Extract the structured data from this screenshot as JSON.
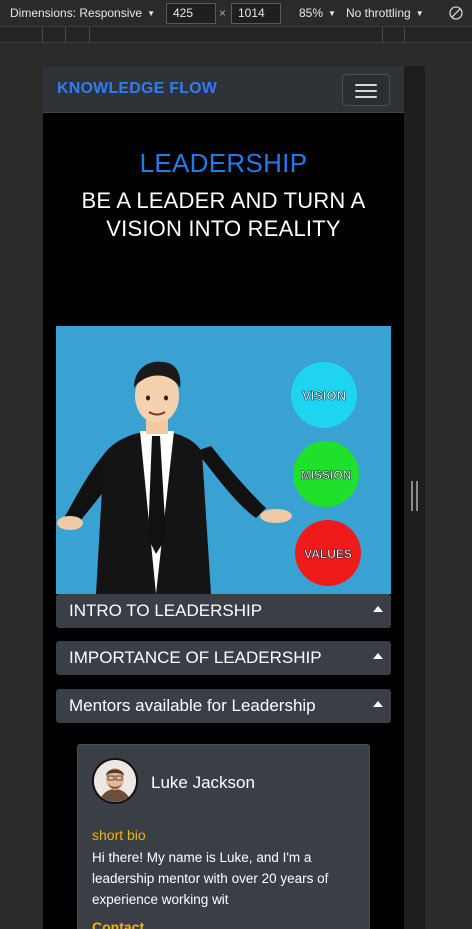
{
  "devtools": {
    "dimensions_label": "Dimensions: Responsive",
    "width": "425",
    "height": "1014",
    "times": "×",
    "zoom": "85%",
    "throttling": "No throttling"
  },
  "site": {
    "brand": "KNOWLEDGE FLOW",
    "hero": {
      "title": "LEADERSHIP",
      "subtitle": "BE A LEADER AND TURN A VISION INTO REALITY"
    },
    "illustration": {
      "circles": [
        {
          "label": "VISION",
          "color": "#1ed4f0"
        },
        {
          "label": "MISSION",
          "color": "#1fe12b"
        },
        {
          "label": "VALUES",
          "color": "#ef1a1a"
        }
      ]
    },
    "accordion": [
      {
        "label": "INTRO TO LEADERSHIP"
      },
      {
        "label": "IMPORTANCE OF LEADERSHIP"
      },
      {
        "label": "Mentors available for Leadership"
      }
    ],
    "mentor": {
      "name": "Luke Jackson",
      "bio_label": "short bio",
      "bio": "Hi there! My name is Luke, and I'm a leadership mentor with over 20 years of experience working wit",
      "contact_label": "Contact"
    }
  },
  "colors": {
    "brand": "#2f7df3",
    "hero_title": "#1e7bf0",
    "accent_label": "#f4b400",
    "panel": "#3a3e45"
  }
}
